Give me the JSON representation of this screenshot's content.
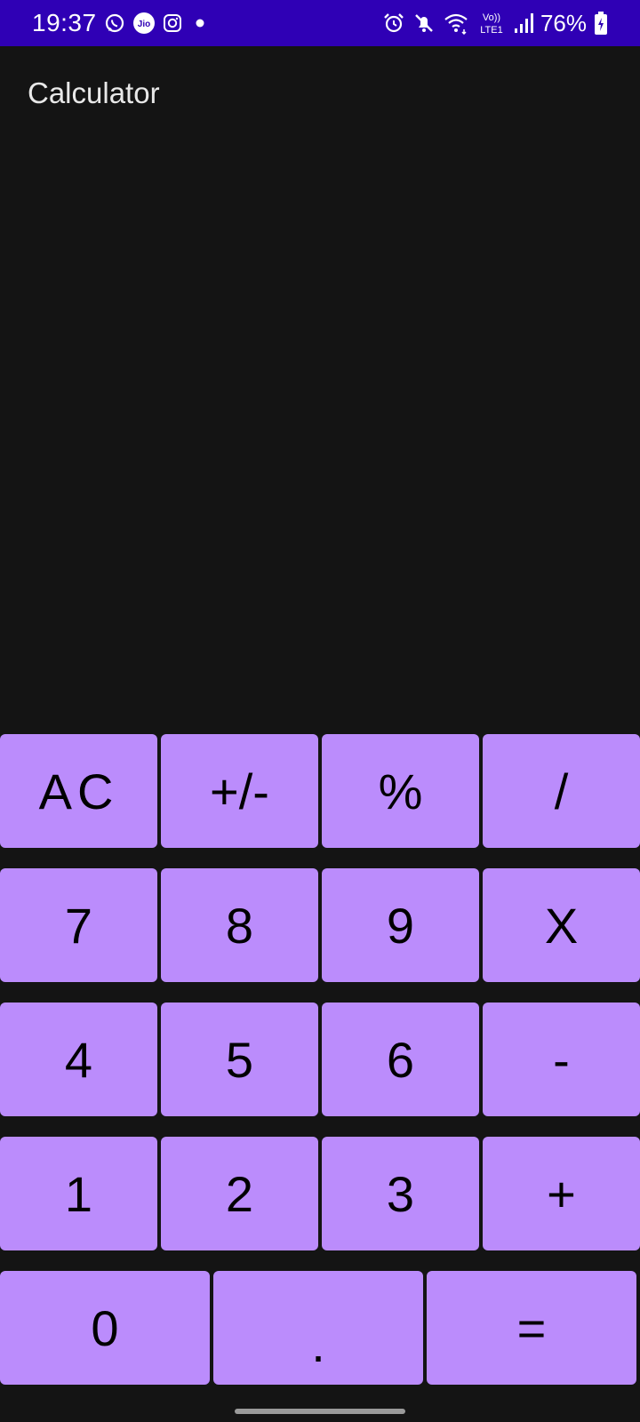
{
  "status_bar": {
    "time": "19:37",
    "left_icons": [
      "whatsapp-icon",
      "jio-icon",
      "instagram-icon",
      "notification-dot-icon"
    ],
    "jio_text": "Jio",
    "right_icons": [
      "alarm-icon",
      "mute-icon",
      "wifi-icon",
      "volte-icon",
      "signal-icon",
      "battery-icon"
    ],
    "volte_top": "Vo))",
    "volte_bottom": "LTE1",
    "battery_percent": "76%",
    "color": "#2f00b5"
  },
  "app": {
    "title": "Calculator",
    "display_value": ""
  },
  "keypad": {
    "key_color": "#bb8cfc",
    "rows": [
      [
        "AC",
        "+/-",
        "%",
        "/"
      ],
      [
        "7",
        "8",
        "9",
        "X"
      ],
      [
        "4",
        "5",
        "6",
        "-"
      ],
      [
        "1",
        "2",
        "3",
        "+"
      ],
      [
        "0",
        ".",
        "="
      ]
    ]
  }
}
